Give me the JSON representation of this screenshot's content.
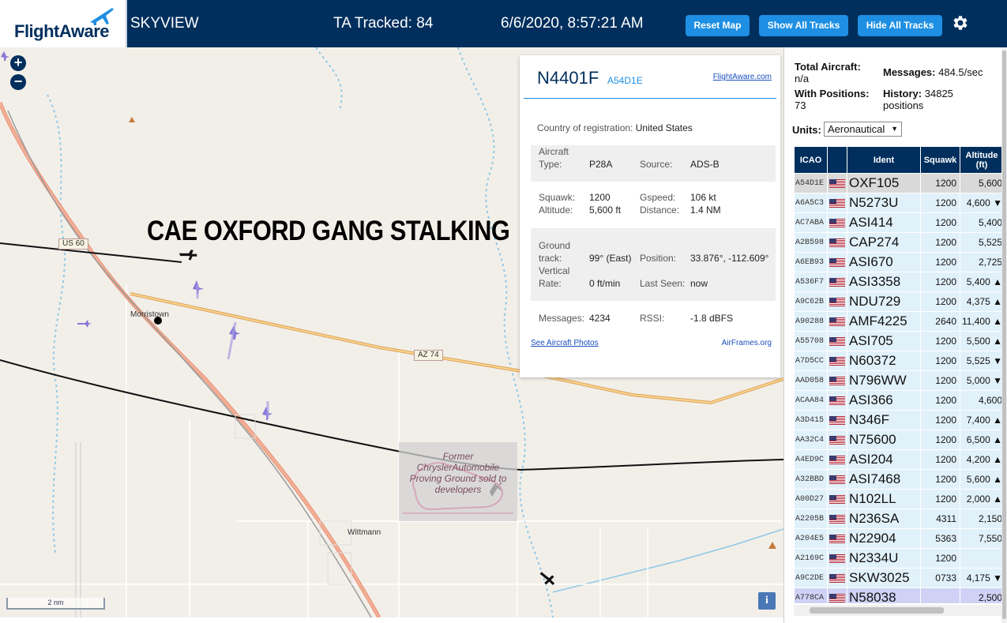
{
  "header": {
    "logo_text": "FlightAware",
    "app_name": "SKYVIEW",
    "tracked": "TA Tracked: 84",
    "datetime": "6/6/2020, 8:57:21 AM",
    "reset_label": "Reset Map",
    "show_label": "Show All Tracks",
    "hide_label": "Hide All Tracks",
    "gear_icon": "gear-icon"
  },
  "map": {
    "overlay_text": "CAE OXFORD GANG STALKING",
    "labels": {
      "morristown": "Morristown",
      "wittmann": "Wittmann",
      "us60": "US 60",
      "az74": "AZ 74",
      "proving_ground": "Former ChryslerAutomobile Proving Ground sold to developers"
    },
    "scale": "2 nm",
    "zoom_in": "+",
    "zoom_out": "−",
    "info": "i",
    "colors": {
      "highway": "#e9967a",
      "road": "#f4b860",
      "track": "#111111",
      "water": "#8fc8e6"
    }
  },
  "popup": {
    "ident": "N4401F",
    "icao": "A54D1E",
    "flightaware_link": "FlightAware.com",
    "country_label": "Country of registration:",
    "country": "United States",
    "aircraft_type_label": "Aircraft Type:",
    "aircraft_type": "P28A",
    "source_label": "Source:",
    "source": "ADS-B",
    "squawk_label": "Squawk:",
    "squawk": "1200",
    "altitude_label": "Altitude:",
    "altitude": "5,600 ft",
    "gspeed_label": "Gspeed:",
    "gspeed": "106 kt",
    "distance_label": "Distance:",
    "distance": "1.4 NM",
    "ground_track_label": "Ground track:",
    "ground_track": "99° (East)",
    "position_label": "Position:",
    "position": "33.876°, -112.609°",
    "vertical_rate_label": "Vertical Rate:",
    "vertical_rate": "0 ft/min",
    "last_seen_label": "Last Seen:",
    "last_seen": "now",
    "messages_label": "Messages:",
    "messages": "4234",
    "rssi_label": "RSSI:",
    "rssi": "-1.8 dBFS",
    "photos_link": "See Aircraft Photos",
    "airframes_link": "AirFrames.org"
  },
  "side": {
    "total_label": "Total Aircraft:",
    "total": "n/a",
    "with_pos_label": "With Positions:",
    "with_pos": "73",
    "messages_label": "Messages:",
    "messages": "484.5/sec",
    "history_label": "History:",
    "history": "34825 positions",
    "units_label": "Units:",
    "units_value": "Aeronautical",
    "columns": [
      "ICAO",
      "",
      "Ident",
      "Squawk",
      "Altitude (ft)"
    ],
    "rows": [
      {
        "icao": "A54D1E",
        "ident": "OXF105",
        "squawk": "1200",
        "alt": "5,600"
      },
      {
        "icao": "A6A5C3",
        "ident": "N5273U",
        "squawk": "1200",
        "alt": "4,600 ▼"
      },
      {
        "icao": "AC7ABA",
        "ident": "ASI414",
        "squawk": "1200",
        "alt": "5,400"
      },
      {
        "icao": "A2B598",
        "ident": "CAP274",
        "squawk": "1200",
        "alt": "5,525"
      },
      {
        "icao": "A6EB93",
        "ident": "ASI670",
        "squawk": "1200",
        "alt": "2,725"
      },
      {
        "icao": "A536F7",
        "ident": "ASI3358",
        "squawk": "1200",
        "alt": "5,400 ▲"
      },
      {
        "icao": "A9C62B",
        "ident": "NDU729",
        "squawk": "1200",
        "alt": "4,375 ▲"
      },
      {
        "icao": "A90288",
        "ident": "AMF4225",
        "squawk": "2640",
        "alt": "11,400 ▲"
      },
      {
        "icao": "A55708",
        "ident": "ASI705",
        "squawk": "1200",
        "alt": "5,500 ▲"
      },
      {
        "icao": "A7D5CC",
        "ident": "N60372",
        "squawk": "1200",
        "alt": "5,525 ▼"
      },
      {
        "icao": "AAD058",
        "ident": "N796WW",
        "squawk": "1200",
        "alt": "5,000 ▼"
      },
      {
        "icao": "ACAA84",
        "ident": "ASI366",
        "squawk": "1200",
        "alt": "4,600"
      },
      {
        "icao": "A3D415",
        "ident": "N346F",
        "squawk": "1200",
        "alt": "7,400 ▲"
      },
      {
        "icao": "AA32C4",
        "ident": "N75600",
        "squawk": "1200",
        "alt": "6,500 ▲"
      },
      {
        "icao": "A4ED9C",
        "ident": "ASI204",
        "squawk": "1200",
        "alt": "4,200 ▲"
      },
      {
        "icao": "A32BBD",
        "ident": "ASI7468",
        "squawk": "1200",
        "alt": "5,600 ▲"
      },
      {
        "icao": "A00D27",
        "ident": "N102LL",
        "squawk": "1200",
        "alt": "2,000 ▲"
      },
      {
        "icao": "A2205B",
        "ident": "N236SA",
        "squawk": "4311",
        "alt": "2,150"
      },
      {
        "icao": "A204E5",
        "ident": "N22904",
        "squawk": "5363",
        "alt": "7,550"
      },
      {
        "icao": "A2169C",
        "ident": "N2334U",
        "squawk": "1200",
        "alt": ""
      },
      {
        "icao": "A9C2DE",
        "ident": "SKW3025",
        "squawk": "0733",
        "alt": "4,175 ▼"
      },
      {
        "icao": "A778CA",
        "ident": "N58038",
        "squawk": "",
        "alt": "2,500"
      }
    ]
  }
}
